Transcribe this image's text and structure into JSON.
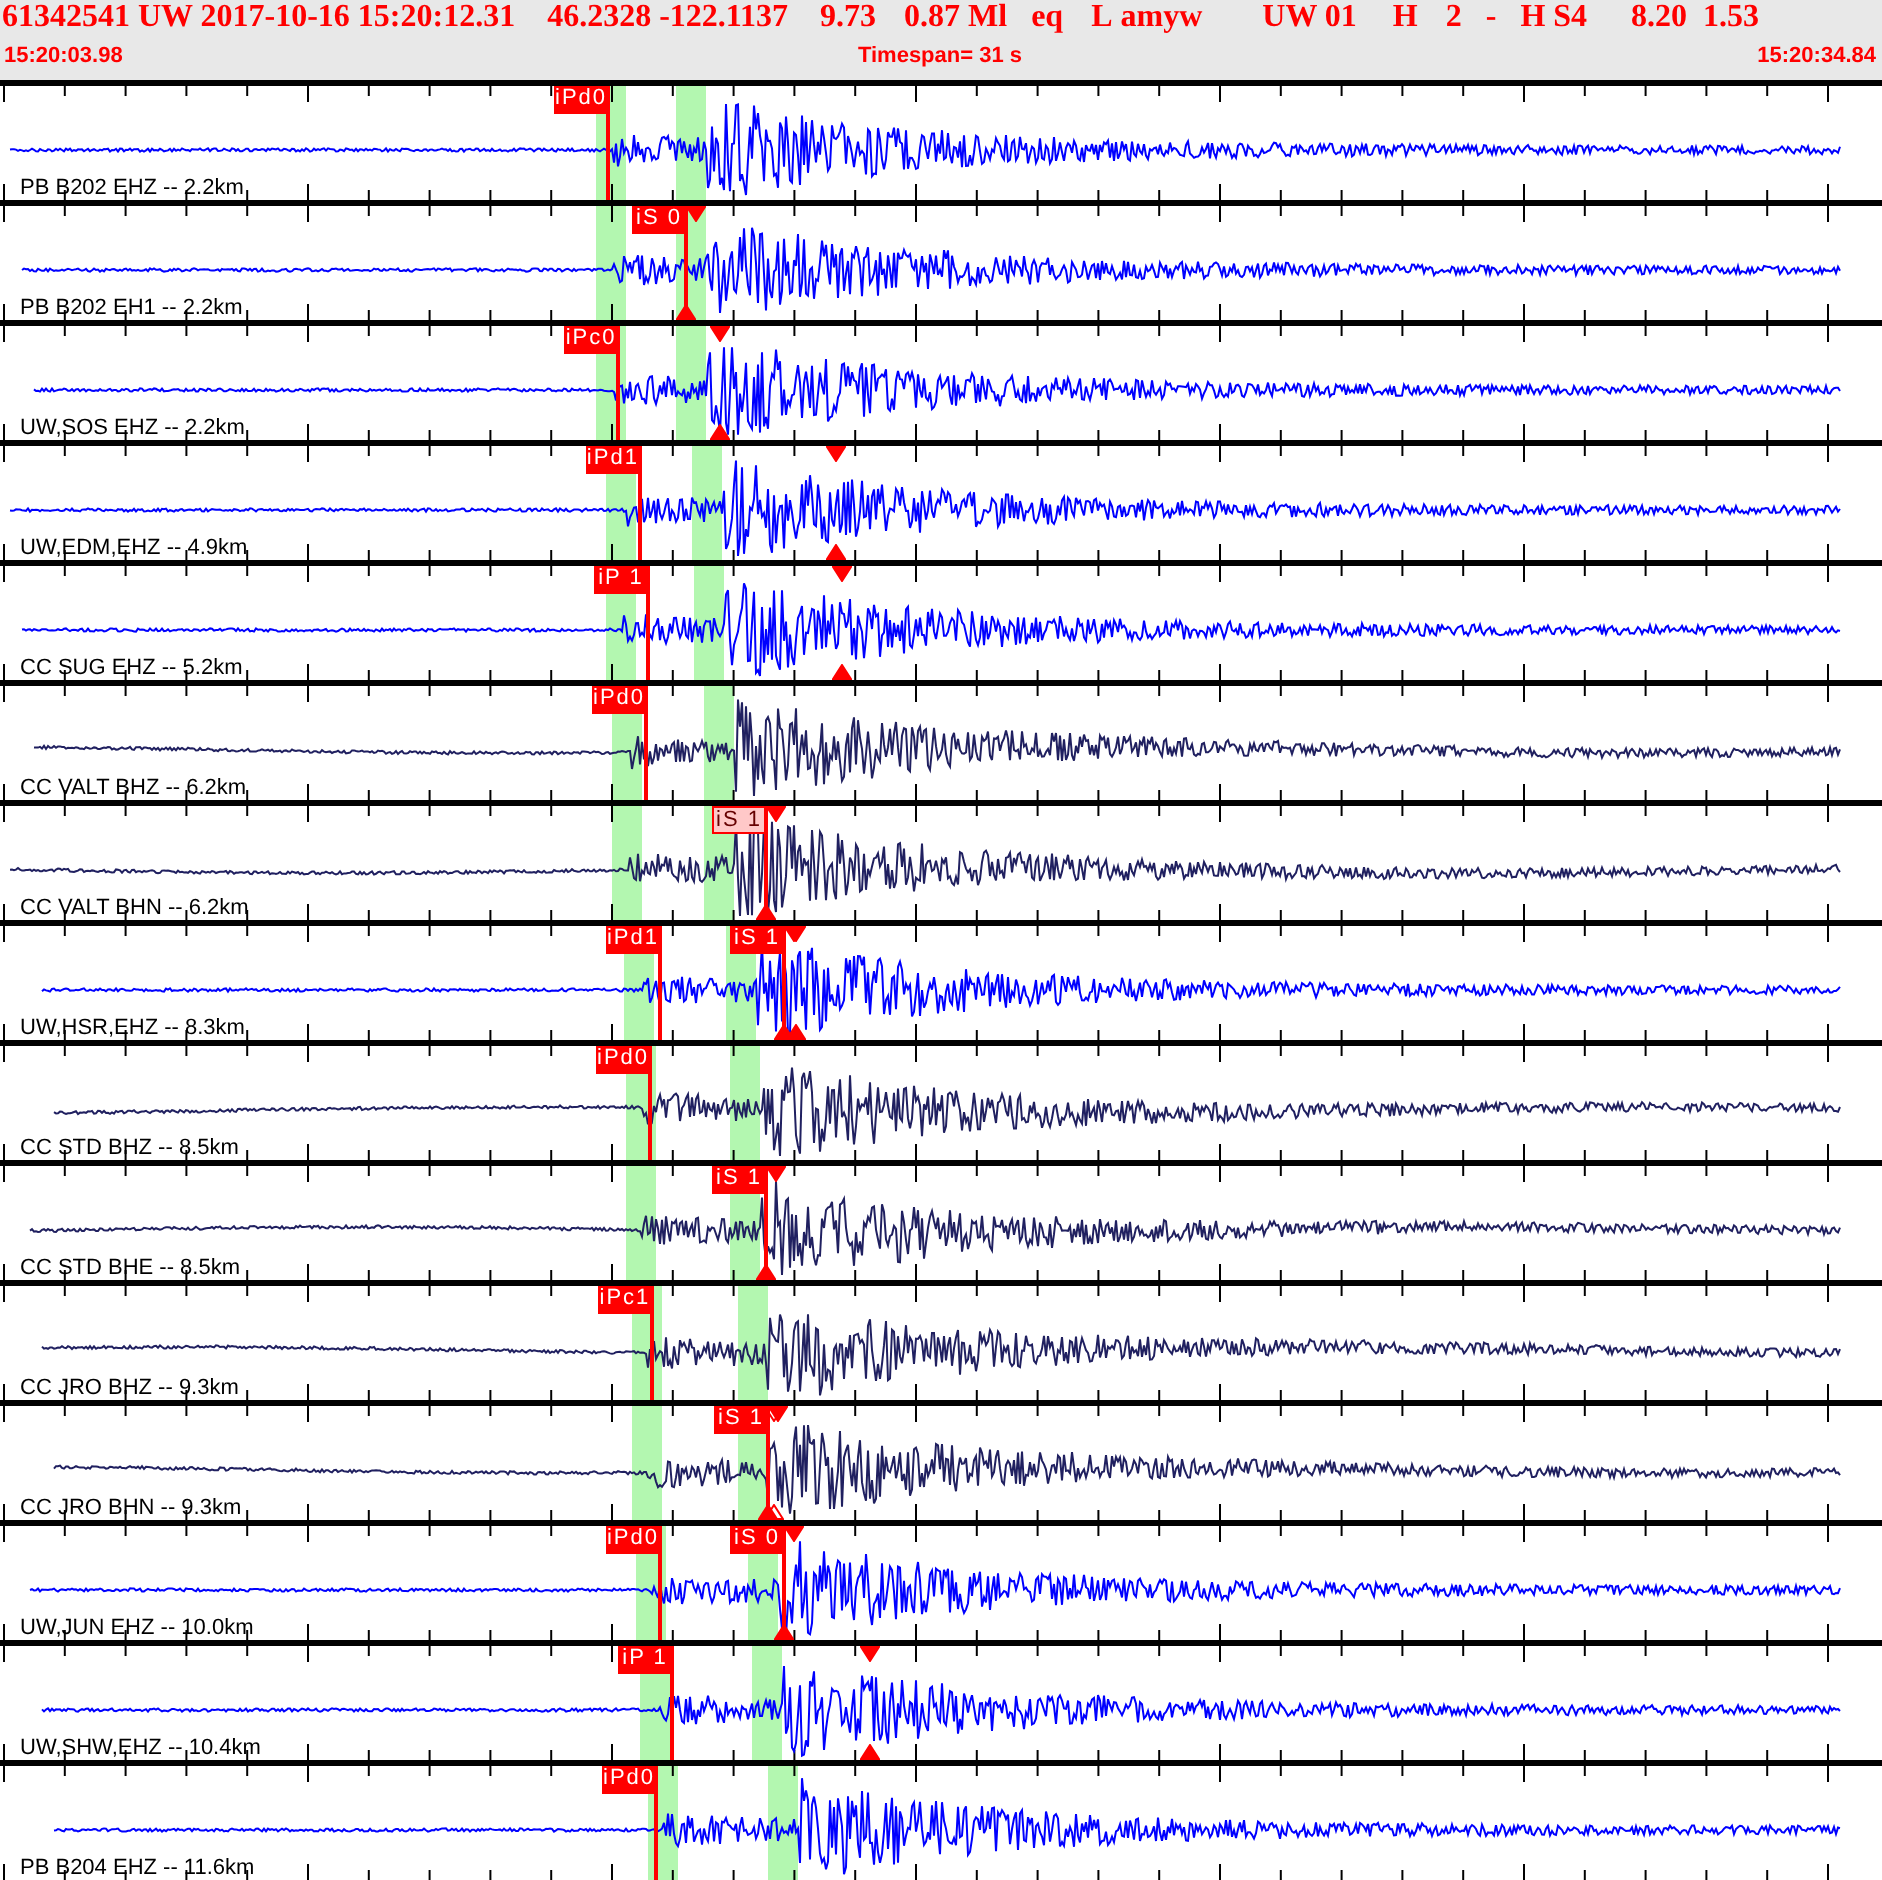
{
  "header": {
    "fields": [
      "61342541 UW 2017-10-16 15:20:12.31",
      "46.2328 -122.1137",
      "9.73",
      "0.87 Ml",
      "eq",
      "L",
      "amyw",
      "UW 01",
      "H",
      "2",
      "-",
      "H S4",
      "8.20",
      "1.53"
    ],
    "start_time": "15:20:03.98",
    "timespan": "Timespan=  31 s",
    "end_time": "15:20:34.84"
  },
  "traces": [
    {
      "label": "PB B202 EHZ -- 2.2km",
      "color": "#0000ff",
      "bands": [
        {
          "level": 0.3167
        },
        {
          "level": 0.3592
        }
      ],
      "picks": [
        {
          "kind": "P",
          "label": "iPd0",
          "selected": false,
          "level": 0.3231
        }
      ]
    },
    {
      "label": "PB B202 EH1 -- 2.2km",
      "color": "#0000ff",
      "bands": [
        {
          "level": 0.3167
        },
        {
          "level": 0.3592
        }
      ],
      "picks": [
        {
          "kind": "S",
          "label": "iS 0",
          "selected": false,
          "level": 0.3645
        }
      ]
    },
    {
      "label": "UW,SOS EHZ -- 2.2km",
      "color": "#0000ff",
      "bands": [
        {
          "level": 0.3167
        },
        {
          "level": 0.3592
        }
      ],
      "picks": [
        {
          "kind": "P",
          "label": "iPc0",
          "selected": false,
          "level": 0.3284
        }
      ],
      "marks": [
        {
          "level": 0.3826,
          "filled": true
        }
      ]
    },
    {
      "label": "UW,EDM,EHZ -- 4.9km",
      "color": "#0000ff",
      "bands": [
        {
          "level": 0.322
        },
        {
          "level": 0.3677
        }
      ],
      "picks": [
        {
          "kind": "P",
          "label": "iPd1",
          "selected": false,
          "level": 0.34
        }
      ],
      "marks": [
        {
          "level": 0.4442,
          "filled": true
        }
      ]
    },
    {
      "label": "CC SUG EHZ -- 5.2km",
      "color": "#0000ff",
      "bands": [
        {
          "level": 0.322
        },
        {
          "level": 0.3688
        }
      ],
      "picks": [
        {
          "kind": "P",
          "label": "iP 1",
          "selected": false,
          "level": 0.3443
        }
      ],
      "marks": [
        {
          "level": 0.4474,
          "filled": true
        }
      ]
    },
    {
      "label": "CC VALT BHZ -- 6.2km",
      "color": "#202060",
      "bands": [
        {
          "level": 0.3252
        },
        {
          "level": 0.3741
        }
      ],
      "picks": [
        {
          "kind": "P",
          "label": "iPd0",
          "selected": false,
          "level": 0.3433
        }
      ]
    },
    {
      "label": "CC VALT BHN -- 6.2km",
      "color": "#202060",
      "bands": [
        {
          "level": 0.3252
        },
        {
          "level": 0.3741
        }
      ],
      "picks": [
        {
          "kind": "S",
          "label": "iS 1",
          "selected": true,
          "level": 0.407
        }
      ]
    },
    {
      "label": "UW,HSR,EHZ -- 8.3km",
      "color": "#0000ff",
      "bands": [
        {
          "level": 0.3316
        },
        {
          "level": 0.3858
        }
      ],
      "picks": [
        {
          "kind": "P",
          "label": "iPd1",
          "selected": false,
          "level": 0.3507
        },
        {
          "kind": "S",
          "label": "iS 1",
          "selected": false,
          "level": 0.4166
        }
      ],
      "marks": [
        {
          "level": 0.423,
          "filled": true
        }
      ]
    },
    {
      "label": "CC STD BHZ -- 8.5km",
      "color": "#202060",
      "bands": [
        {
          "level": 0.3326
        },
        {
          "level": 0.3879
        }
      ],
      "picks": [
        {
          "kind": "P",
          "label": "iPd0",
          "selected": false,
          "level": 0.3454
        }
      ]
    },
    {
      "label": "CC STD BHE -- 8.5km",
      "color": "#202060",
      "bands": [
        {
          "level": 0.3326
        },
        {
          "level": 0.3879
        }
      ],
      "picks": [
        {
          "kind": "S",
          "label": "iS 1",
          "selected": false,
          "level": 0.407
        }
      ]
    },
    {
      "label": "CC JRO BHZ -- 9.3km",
      "color": "#202060",
      "bands": [
        {
          "level": 0.3358
        },
        {
          "level": 0.3921
        }
      ],
      "picks": [
        {
          "kind": "P",
          "label": "iPc1",
          "selected": false,
          "level": 0.3464
        }
      ]
    },
    {
      "label": "CC JRO BHN -- 9.3km",
      "color": "#202060",
      "bands": [
        {
          "level": 0.3358
        },
        {
          "level": 0.3921
        }
      ],
      "picks": [
        {
          "kind": "S",
          "label": "iS 1",
          "selected": false,
          "level": 0.4081
        }
      ],
      "marks": [
        {
          "level": 0.4113,
          "filled": false
        }
      ]
    },
    {
      "label": "UW,JUN EHZ -- 10.0km",
      "color": "#0000ff",
      "bands": [
        {
          "level": 0.3379
        },
        {
          "level": 0.3974
        }
      ],
      "picks": [
        {
          "kind": "P",
          "label": "iPd0",
          "selected": false,
          "level": 0.3507
        },
        {
          "kind": "S",
          "label": "iS 0",
          "selected": false,
          "level": 0.4166
        }
      ]
    },
    {
      "label": "UW,SHW,EHZ -- 10.4km",
      "color": "#0000ff",
      "bands": [
        {
          "level": 0.3401
        },
        {
          "level": 0.3996
        }
      ],
      "picks": [
        {
          "kind": "P",
          "label": "iP 1",
          "selected": false,
          "level": 0.3571
        }
      ],
      "marks": [
        {
          "level": 0.4623,
          "filled": true
        }
      ]
    },
    {
      "label": "PB B204 EHZ -- 11.6km",
      "color": "#0000ff",
      "bands": [
        {
          "level": 0.3443
        },
        {
          "level": 0.4081
        }
      ],
      "picks": [
        {
          "kind": "P",
          "label": "iPd0",
          "selected": false,
          "level": 0.3486
        }
      ]
    }
  ]
}
